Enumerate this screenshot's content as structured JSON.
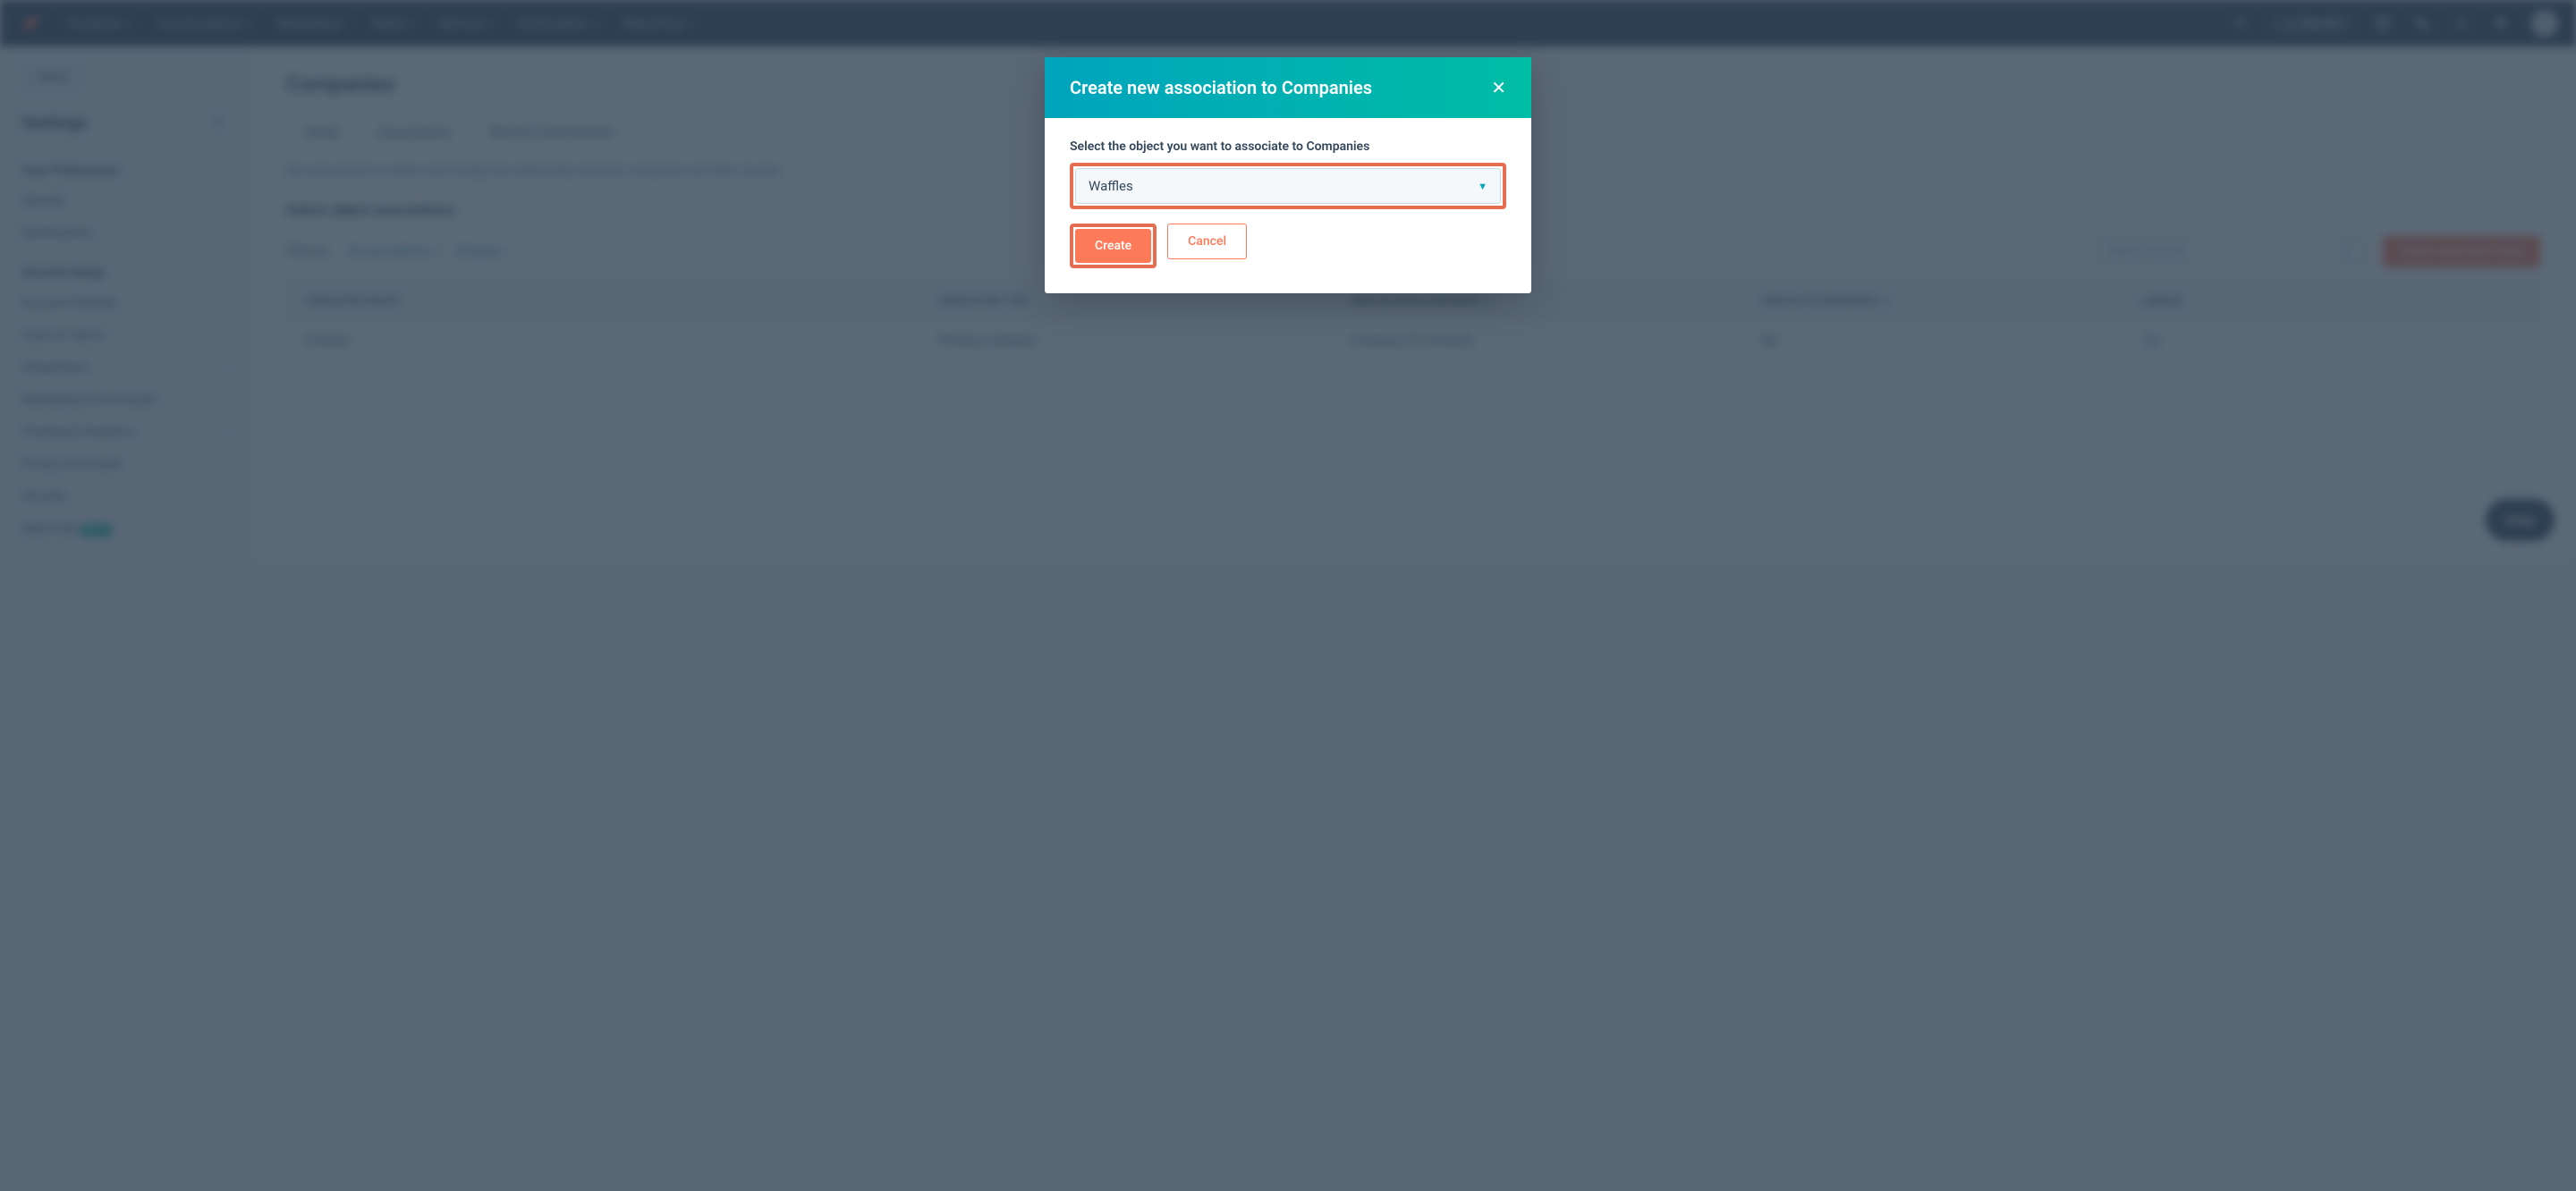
{
  "topnav": {
    "items": [
      "Contacts",
      "Conversations",
      "Marketing",
      "Sales",
      "Service",
      "Automation",
      "Reporting"
    ],
    "upgrade": "Upgrade"
  },
  "sidebar": {
    "back": "Back",
    "heading": "Settings",
    "group1_title": "Your Preferences",
    "group1": [
      "General",
      "Notifications"
    ],
    "group2_title": "Account Setup",
    "group2": [
      {
        "label": "Account Defaults",
        "chevron": false
      },
      {
        "label": "Users & Teams",
        "chevron": false
      },
      {
        "label": "Integrations",
        "chevron": true
      },
      {
        "label": "Marketplace Downloads",
        "chevron": false
      },
      {
        "label": "Tracking & Analytics",
        "chevron": true
      },
      {
        "label": "Privacy & Consent",
        "chevron": false
      },
      {
        "label": "Security",
        "chevron": false
      },
      {
        "label": "Approvals",
        "chevron": false,
        "beta": true
      }
    ]
  },
  "main": {
    "title": "Companies",
    "tabs": [
      "Setup",
      "Associations",
      "Record Customization"
    ],
    "active_tab": 1,
    "desc": "Use associations to define and manage the relationships between companies and other records.",
    "section_title": "Select object associations",
    "filter_label": "Filter by:",
    "filter1": "All associations",
    "filter2": "All types",
    "search_placeholder": "Search records",
    "create_btn": "Create association label",
    "cols": [
      "ASSOCIATED OBJECT",
      "ASSOCIATION TYPE",
      "USED IN (FROM COMPANIES)",
      "USED IN (TO COMPANIES)",
      "LABELED"
    ],
    "row": {
      "obj": "Contact",
      "type": "Primary company",
      "from": "Company-To-Contacts",
      "to": "No",
      "labeled": "0"
    }
  },
  "modal": {
    "title": "Create new association to Companies",
    "label": "Select the object you want to associate to Companies",
    "selected": "Waffles",
    "create": "Create",
    "cancel": "Cancel"
  },
  "help": "Help"
}
